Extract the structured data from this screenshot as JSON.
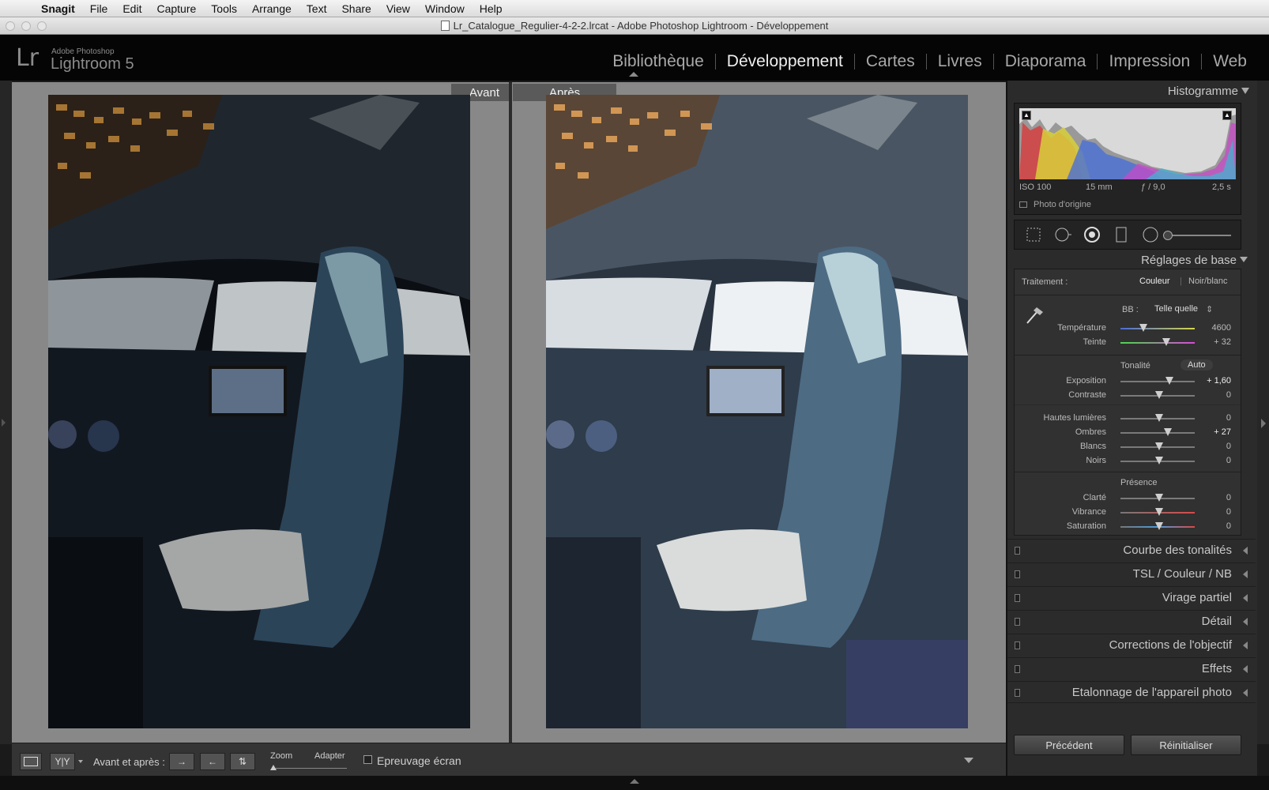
{
  "menubar": {
    "app_name": "Snagit",
    "items": [
      "File",
      "Edit",
      "Capture",
      "Tools",
      "Arrange",
      "Text",
      "Share",
      "View",
      "Window",
      "Help"
    ]
  },
  "window": {
    "title": "Lr_Catalogue_Regulier-4-2-2.lrcat - Adobe Photoshop Lightroom - Développement"
  },
  "lightroom": {
    "logo": "Lr",
    "brand_small": "Adobe Photoshop",
    "brand_large": "Lightroom 5",
    "modules": [
      "Bibliothèque",
      "Développement",
      "Cartes",
      "Livres",
      "Diaporama",
      "Impression",
      "Web"
    ],
    "active_module": "Développement"
  },
  "compare": {
    "before_label": "Avant",
    "after_label": "Après"
  },
  "histogram": {
    "title": "Histogramme",
    "iso": "ISO 100",
    "focal": "15 mm",
    "aperture": "ƒ / 9,0",
    "shutter": "2,5 s",
    "original_photo": "Photo d'origine"
  },
  "basic": {
    "title": "Réglages de base",
    "treatment_label": "Traitement :",
    "treatment_color": "Couleur",
    "treatment_bw": "Noir/blanc",
    "wb_label": "BB :",
    "wb_value": "Telle quelle",
    "tone_label": "Tonalité",
    "auto_label": "Auto",
    "presence_label": "Présence",
    "sliders": [
      {
        "label": "Température",
        "value": "4600",
        "pos": 0.28
      },
      {
        "label": "Teinte",
        "value": "+ 32",
        "pos": 0.6
      },
      {
        "label": "Exposition",
        "value": "+ 1,60",
        "pos": 0.64
      },
      {
        "label": "Contraste",
        "value": "0",
        "pos": 0.5
      },
      {
        "label": "Hautes lumières",
        "value": "0",
        "pos": 0.5
      },
      {
        "label": "Ombres",
        "value": "+ 27",
        "pos": 0.63
      },
      {
        "label": "Blancs",
        "value": "0",
        "pos": 0.5
      },
      {
        "label": "Noirs",
        "value": "0",
        "pos": 0.5
      },
      {
        "label": "Clarté",
        "value": "0",
        "pos": 0.5
      },
      {
        "label": "Vibrance",
        "value": "0",
        "pos": 0.5
      },
      {
        "label": "Saturation",
        "value": "0",
        "pos": 0.5
      }
    ]
  },
  "panels": {
    "tone_curve": "Courbe des tonalités",
    "hsl": "TSL / Couleur / NB",
    "split": "Virage partiel",
    "detail": "Détail",
    "lens": "Corrections de l'objectif",
    "effects": "Effets",
    "camera": "Etalonnage de l'appareil photo"
  },
  "buttons": {
    "previous": "Précédent",
    "reset": "Réinitialiser"
  },
  "toolbar": {
    "before_after": "Avant et après :",
    "zoom": "Zoom",
    "fit": "Adapter",
    "softproof": "Epreuvage écran"
  },
  "colors": {
    "accent": "#efefef",
    "panel_bg": "#2b2b2b",
    "canvas_bg": "#888888"
  }
}
